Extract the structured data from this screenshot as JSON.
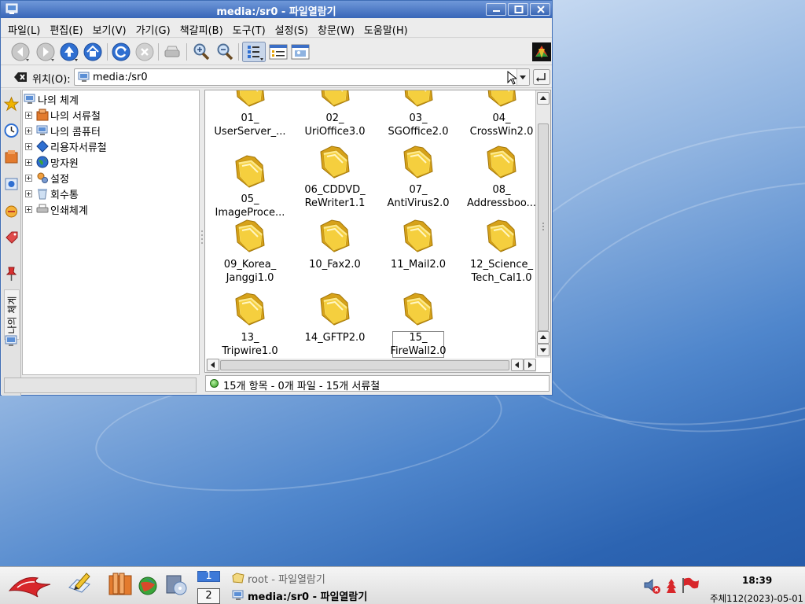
{
  "window": {
    "title": "media:/sr0 - 파일열람기",
    "buttons": {
      "minimize": "minimize",
      "maximize": "maximize",
      "close": "close"
    }
  },
  "menu": [
    "파일(L)",
    "편집(E)",
    "보기(V)",
    "가기(G)",
    "책갈피(B)",
    "도구(T)",
    "설정(S)",
    "창문(W)",
    "도움말(H)"
  ],
  "toolbar": {
    "icons": [
      "back-icon",
      "forward-icon",
      "up-icon",
      "home-icon",
      "reload-icon",
      "stop-icon",
      "print-icon",
      "zoom-in-icon",
      "zoom-out-icon",
      "icon-view-icon",
      "detail-view-icon",
      "preview-icon"
    ]
  },
  "location": {
    "label": "위치(O):",
    "value": "media:/sr0"
  },
  "sidebar": {
    "vertical_tab_label": "나의 체계",
    "root": "나의 체계",
    "items": [
      "나의 서류철",
      "나의 콤퓨터",
      "리용자서류철",
      "망자원",
      "설정",
      "회수통",
      "인쇄체계"
    ]
  },
  "files": [
    {
      "line1": "01_",
      "line2": "UserServer_..."
    },
    {
      "line1": "02_",
      "line2": "UriOffice3.0"
    },
    {
      "line1": "03_",
      "line2": "SGOffice2.0"
    },
    {
      "line1": "04_",
      "line2": "CrossWin2.0"
    },
    {
      "line1": "05_",
      "line2": "ImageProce..."
    },
    {
      "line1": "06_CDDVD_",
      "line2": "ReWriter1.1"
    },
    {
      "line1": "07_",
      "line2": "AntiVirus2.0"
    },
    {
      "line1": "08_",
      "line2": "Addressboo..."
    },
    {
      "line1": "09_Korea_",
      "line2": "Janggi1.0"
    },
    {
      "line1": "10_Fax2.0",
      "line2": ""
    },
    {
      "line1": "11_Mail2.0",
      "line2": ""
    },
    {
      "line1": "12_Science_",
      "line2": "Tech_Cal1.0"
    },
    {
      "line1": "13_",
      "line2": "Tripwire1.0"
    },
    {
      "line1": "14_GFTP2.0",
      "line2": ""
    },
    {
      "line1": "15_",
      "line2": "FireWall2.0"
    }
  ],
  "status": "15개 항목 - 0개 파일 - 15개 서류철",
  "taskbar": {
    "pager": [
      "1",
      "2"
    ],
    "tasks": [
      {
        "label": "root - 파일열람기",
        "active": false
      },
      {
        "label": "media:/sr0 - 파일열람기",
        "active": true
      }
    ],
    "clock": "18:39",
    "date": "주체112(2023)-05-01"
  },
  "colors": {
    "titlebar": "#3866b8",
    "folder": "#f2c430",
    "selection": "#3d79d8"
  }
}
